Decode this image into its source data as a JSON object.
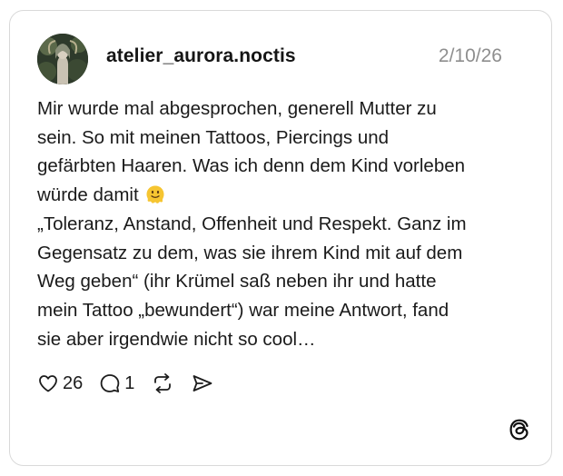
{
  "post": {
    "username": "atelier_aurora.noctis",
    "date": "2/10/26",
    "text_lines": [
      "Mir wurde mal abgesprochen, generell Mutter zu",
      "sein. So mit meinen Tattoos, Piercings und",
      "gefärbten Haaren. Was ich denn dem Kind vorleben",
      "würde damit",
      "„Toleranz, Anstand, Offenheit und Respekt. Ganz im",
      "Gegensatz zu dem, was sie ihrem Kind mit auf dem",
      "Weg geben“ (ihr Krümel saß neben ihr und hatte",
      "mein Tattoo „bewundert“) war meine Antwort, fand",
      "sie aber irgendwie nicht so cool…"
    ],
    "emoji": "melting-face-emoji"
  },
  "actions": {
    "like_icon": "heart-icon",
    "like_count": "26",
    "reply_icon": "comment-icon",
    "reply_count": "1",
    "repost_icon": "repost-icon",
    "share_icon": "send-icon"
  },
  "branding": {
    "logo": "threads-logo-icon"
  },
  "colors": {
    "text": "#1a1a1a",
    "muted": "#8e8e8e",
    "border": "#d9d9d9",
    "emoji": "#f6c531"
  }
}
